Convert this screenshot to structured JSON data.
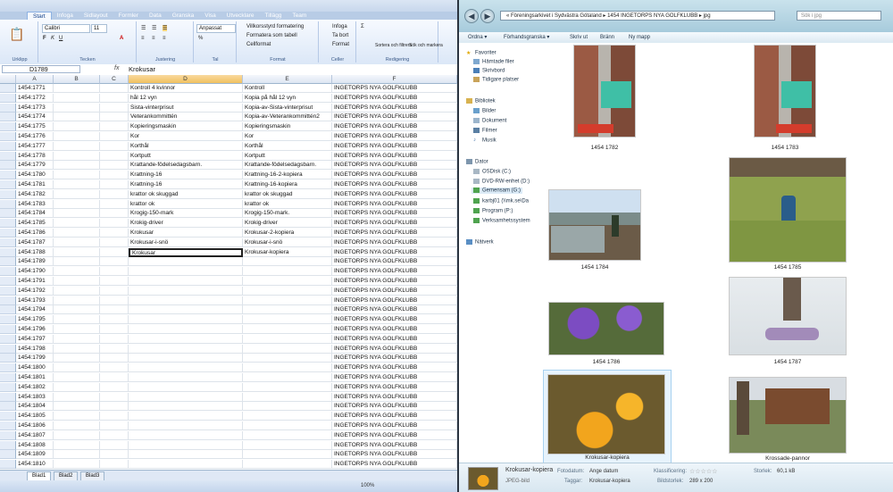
{
  "excel": {
    "ribbon_tabs": [
      "Start",
      "Infoga",
      "Sidlayout",
      "Formler",
      "Data",
      "Granska",
      "Visa",
      "Utvecklare",
      "Tillägg",
      "Team"
    ],
    "font_name": "Calibri",
    "font_size": "11",
    "number_format": "Anpassat",
    "group_labels": [
      "Urklipp",
      "Tecken",
      "Justering",
      "Tal",
      "Format",
      "Celler",
      "Redigering"
    ],
    "format_buttons": [
      "Villkorsstyrd formatering",
      "Formatera som tabell",
      "Cellformat"
    ],
    "cell_buttons": [
      "Infoga",
      "Ta bort",
      "Format"
    ],
    "edit_buttons": [
      "Sortera och filtrera",
      "Sök och markera"
    ],
    "name_box": "D1789",
    "formula_value": "Krokusar",
    "fx_label": "fx",
    "columns": [
      "A",
      "B",
      "C",
      "D",
      "E",
      "F"
    ],
    "rows": [
      {
        "a": "1454:1771",
        "d": "Kontroll 4 kvinnor",
        "e": "Kontroll",
        "f": "INGETORPS NYA GOLFKLUBB"
      },
      {
        "a": "1454:1772",
        "d": "hål 12 vyn",
        "e": "Kopia på hål 12 vyn",
        "f": "INGETORPS NYA GOLFKLUBB"
      },
      {
        "a": "1454:1773",
        "d": "Sista-vinterprisut",
        "e": "Kopia-av-Sista-vinterprisut",
        "f": "INGETORPS NYA GOLFKLUBB"
      },
      {
        "a": "1454:1774",
        "d": "Veterankommittén",
        "e": "Kopia-av-Veterankommittén2",
        "f": "INGETORPS NYA GOLFKLUBB"
      },
      {
        "a": "1454:1775",
        "d": "Kopieringsmaskin",
        "e": "Kopieringsmaskin",
        "f": "INGETORPS NYA GOLFKLUBB"
      },
      {
        "a": "1454:1776",
        "d": "Kor",
        "e": "Kor",
        "f": "INGETORPS NYA GOLFKLUBB"
      },
      {
        "a": "1454:1777",
        "d": "Korthål",
        "e": "Korthål",
        "f": "INGETORPS NYA GOLFKLUBB"
      },
      {
        "a": "1454:1778",
        "d": "Kortputt",
        "e": "Kortputt",
        "f": "INGETORPS NYA GOLFKLUBB"
      },
      {
        "a": "1454:1779",
        "d": "Krattande-födelsedagsbarn.",
        "e": "Krattande-födelsedagsbarn.",
        "f": "INGETORPS NYA GOLFKLUBB"
      },
      {
        "a": "1454:1780",
        "d": "Krattning-16",
        "e": "Krattning-16-2-kopiera",
        "f": "INGETORPS NYA GOLFKLUBB"
      },
      {
        "a": "1454:1781",
        "d": "Krattning-16",
        "e": "Krattning-16-kopiera",
        "f": "INGETORPS NYA GOLFKLUBB"
      },
      {
        "a": "1454:1782",
        "d": "krattor ok skuggad",
        "e": "krattor ok skuggad",
        "f": "INGETORPS NYA GOLFKLUBB"
      },
      {
        "a": "1454:1783",
        "d": "krattor ok",
        "e": "krattor ok",
        "f": "INGETORPS NYA GOLFKLUBB"
      },
      {
        "a": "1454:1784",
        "d": "Krogig-150-mark",
        "e": "Krogig-150-mark.",
        "f": "INGETORPS NYA GOLFKLUBB"
      },
      {
        "a": "1454:1785",
        "d": "Krokig-driver",
        "e": "Krokig-driver",
        "f": "INGETORPS NYA GOLFKLUBB"
      },
      {
        "a": "1454:1786",
        "d": "Krokusar",
        "e": "Krokusar-2-kopiera",
        "f": "INGETORPS NYA GOLFKLUBB"
      },
      {
        "a": "1454:1787",
        "d": "Krokusar-i-snö",
        "e": "Krokusar-i-snö",
        "f": "INGETORPS NYA GOLFKLUBB"
      },
      {
        "a": "1454:1788",
        "d": "Krokusar",
        "e": "Krokusar-kopiera",
        "f": "INGETORPS NYA GOLFKLUBB"
      },
      {
        "a": "1454:1789",
        "d": "",
        "e": "",
        "f": "INGETORPS NYA GOLFKLUBB"
      },
      {
        "a": "1454:1790",
        "d": "",
        "e": "",
        "f": "INGETORPS NYA GOLFKLUBB"
      },
      {
        "a": "1454:1791",
        "d": "",
        "e": "",
        "f": "INGETORPS NYA GOLFKLUBB"
      },
      {
        "a": "1454:1792",
        "d": "",
        "e": "",
        "f": "INGETORPS NYA GOLFKLUBB"
      },
      {
        "a": "1454:1793",
        "d": "",
        "e": "",
        "f": "INGETORPS NYA GOLFKLUBB"
      },
      {
        "a": "1454:1794",
        "d": "",
        "e": "",
        "f": "INGETORPS NYA GOLFKLUBB"
      },
      {
        "a": "1454:1795",
        "d": "",
        "e": "",
        "f": "INGETORPS NYA GOLFKLUBB"
      },
      {
        "a": "1454:1796",
        "d": "",
        "e": "",
        "f": "INGETORPS NYA GOLFKLUBB"
      },
      {
        "a": "1454:1797",
        "d": "",
        "e": "",
        "f": "INGETORPS NYA GOLFKLUBB"
      },
      {
        "a": "1454:1798",
        "d": "",
        "e": "",
        "f": "INGETORPS NYA GOLFKLUBB"
      },
      {
        "a": "1454:1799",
        "d": "",
        "e": "",
        "f": "INGETORPS NYA GOLFKLUBB"
      },
      {
        "a": "1454:1800",
        "d": "",
        "e": "",
        "f": "INGETORPS NYA GOLFKLUBB"
      },
      {
        "a": "1454:1801",
        "d": "",
        "e": "",
        "f": "INGETORPS NYA GOLFKLUBB"
      },
      {
        "a": "1454:1802",
        "d": "",
        "e": "",
        "f": "INGETORPS NYA GOLFKLUBB"
      },
      {
        "a": "1454:1803",
        "d": "",
        "e": "",
        "f": "INGETORPS NYA GOLFKLUBB"
      },
      {
        "a": "1454:1804",
        "d": "",
        "e": "",
        "f": "INGETORPS NYA GOLFKLUBB"
      },
      {
        "a": "1454:1805",
        "d": "",
        "e": "",
        "f": "INGETORPS NYA GOLFKLUBB"
      },
      {
        "a": "1454:1806",
        "d": "",
        "e": "",
        "f": "INGETORPS NYA GOLFKLUBB"
      },
      {
        "a": "1454:1807",
        "d": "",
        "e": "",
        "f": "INGETORPS NYA GOLFKLUBB"
      },
      {
        "a": "1454:1808",
        "d": "",
        "e": "",
        "f": "INGETORPS NYA GOLFKLUBB"
      },
      {
        "a": "1454:1809",
        "d": "",
        "e": "",
        "f": "INGETORPS NYA GOLFKLUBB"
      },
      {
        "a": "1454:1810",
        "d": "",
        "e": "",
        "f": "INGETORPS NYA GOLFKLUBB"
      }
    ],
    "sheets": [
      "Blad1",
      "Blad2",
      "Blad3"
    ],
    "zoom": "100%"
  },
  "explorer": {
    "address": "« Föreningsarkivet i Sydvästra Götaland ▸ 1454 INGETORPS NYA GOLFKLUBB ▸ jpg",
    "search_placeholder": "Sök i jpg",
    "toolbar": [
      "Ordna ▾",
      "Förhandsgranska ▾",
      "Skriv ut",
      "Bränn",
      "Ny mapp"
    ],
    "nav": {
      "favorites": "Favoriter",
      "fav_items": [
        "Hämtade filer",
        "Skrivbord",
        "Tidigare platser"
      ],
      "libraries": "Bibliotek",
      "lib_items": [
        "Bilder",
        "Dokument",
        "Filmer",
        "Musik"
      ],
      "computer": "Dator",
      "comp_items": [
        "OSDisk (C:)",
        "DVD-RW-enhet (D:)",
        "Gemensam (G:)",
        "karbj01 (\\\\mk.se\\Da",
        "Program (P:)",
        "Verksamhetssystem"
      ],
      "network": "Nätverk"
    },
    "thumbs": [
      {
        "caption": "1454 1782"
      },
      {
        "caption": "1454 1783"
      },
      {
        "caption": "1454 1784"
      },
      {
        "caption": "1454 1785"
      },
      {
        "caption": "1454 1786"
      },
      {
        "caption": "1454 1787"
      },
      {
        "caption": "Krokusar-kopiera"
      },
      {
        "caption": "Krossade-pannor"
      }
    ],
    "details": {
      "name": "Krokusar-kopiera",
      "type": "JPEG-bild",
      "date_label": "Fotodatum:",
      "date_value": "Ange datum",
      "tags_label": "Taggar:",
      "tags_value": "Krokusar-kopiera",
      "rating_label": "Klassificering:",
      "rating_stars": "☆☆☆☆☆",
      "dims_label": "Bildstorlek:",
      "dims_value": "289 x 200",
      "size_label": "Storlek:",
      "size_value": "60,1 kB"
    }
  }
}
